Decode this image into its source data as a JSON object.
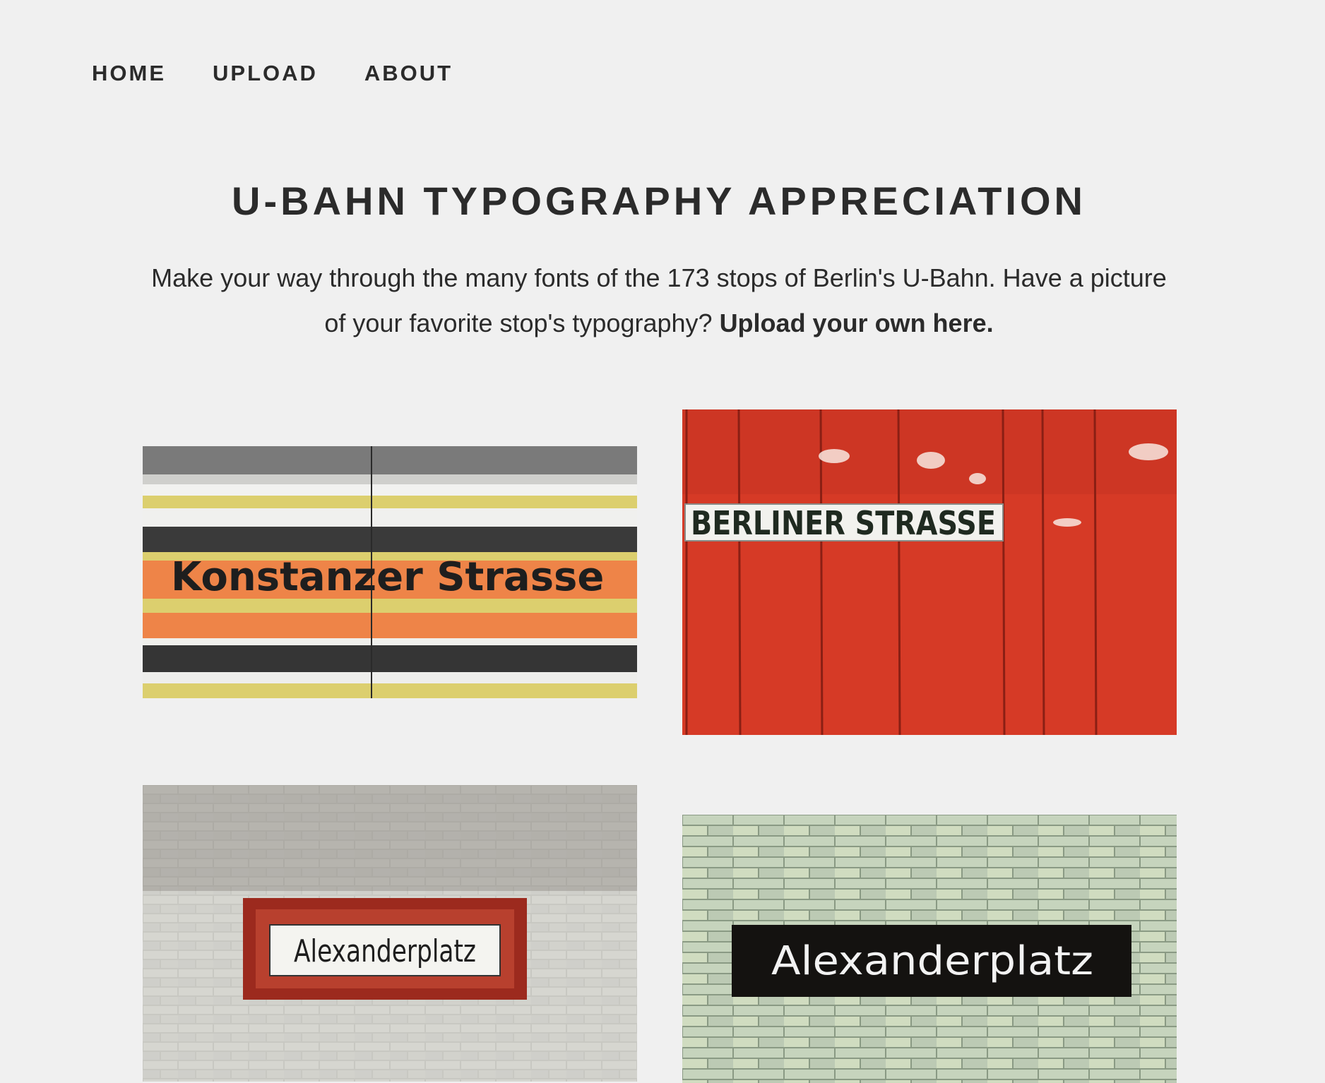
{
  "nav": {
    "items": [
      {
        "label": "HOME"
      },
      {
        "label": "UPLOAD"
      },
      {
        "label": "ABOUT"
      }
    ]
  },
  "header": {
    "title": "U-BAHN TYPOGRAPHY APPRECIATION",
    "intro_text": "Make your way through the many fonts of the 173 stops of Berlin's U-Bahn. Have a picture of your favorite stop's typography? ",
    "intro_link": "Upload your own here."
  },
  "gallery": {
    "photos": [
      {
        "sign_text": "Konstanzer Strasse",
        "colors": {
          "orange": "#ee8448",
          "yellow": "#dccf6e",
          "dark": "#3a3a3a",
          "white": "#ececec"
        }
      },
      {
        "sign_text": "BERLINER STRASSE",
        "colors": {
          "red": "#d63a26",
          "sign_bg": "#f2f2ee",
          "text": "#1f2a20"
        }
      },
      {
        "sign_text": "Alexanderplatz",
        "colors": {
          "tile": "#c8c8c2",
          "frame": "#9c2a1e",
          "sign_bg": "#f4f4f0"
        }
      },
      {
        "sign_text": "Alexanderplatz",
        "colors": {
          "tile": "#c6d4bd",
          "sign_bg": "#141210",
          "text": "#f2f2f2"
        }
      }
    ]
  }
}
